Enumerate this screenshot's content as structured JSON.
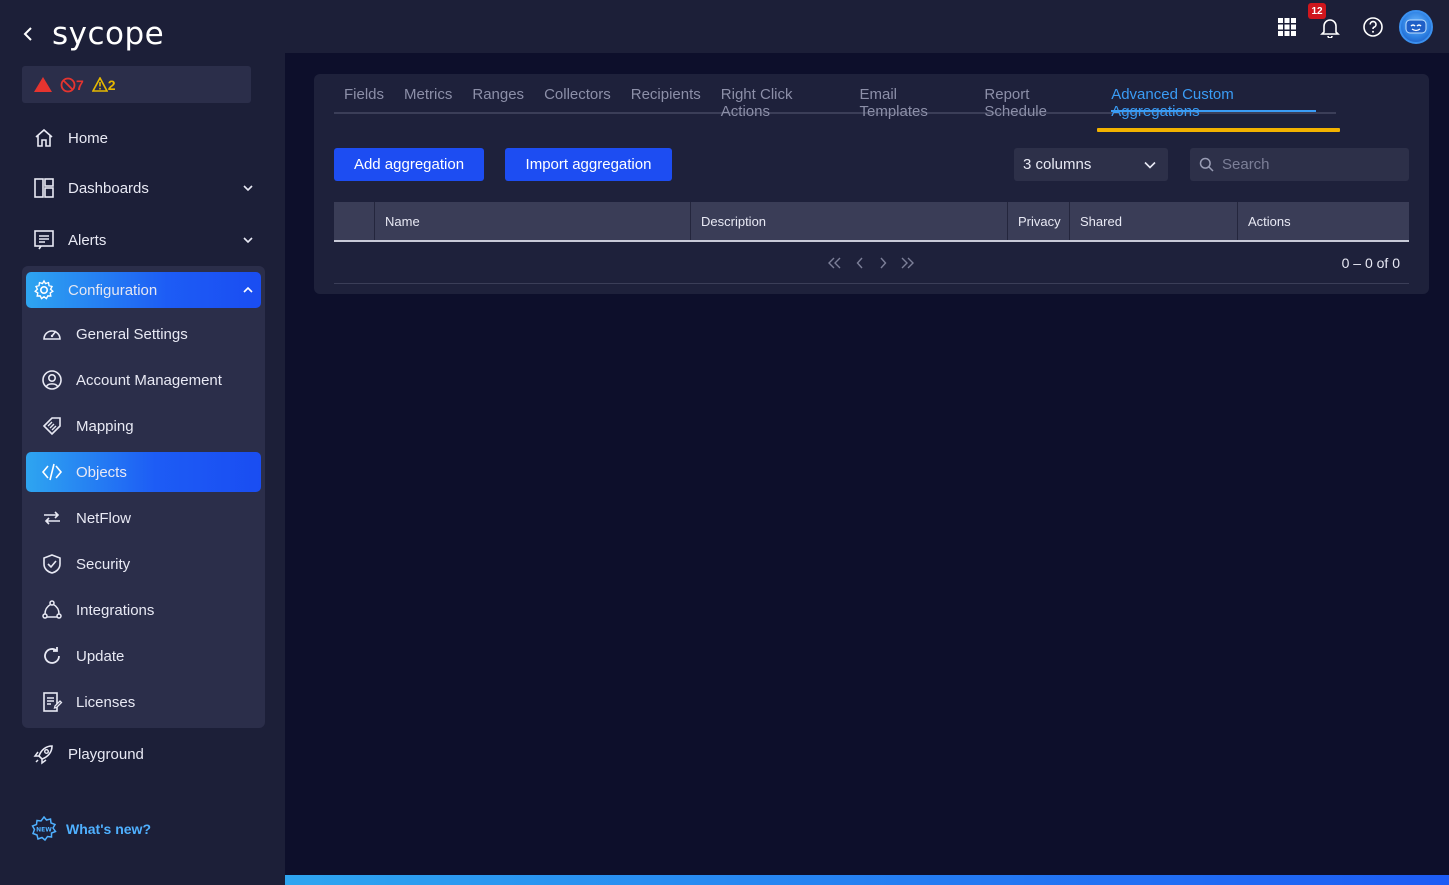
{
  "brand": {
    "logo": "sycope"
  },
  "alerts": {
    "critical_count": "7",
    "warning_count": "2"
  },
  "sidebar": {
    "items": [
      {
        "label": "Home"
      },
      {
        "label": "Dashboards"
      },
      {
        "label": "Alerts"
      }
    ],
    "configuration": {
      "label": "Configuration",
      "sub_items": [
        {
          "label": "General Settings"
        },
        {
          "label": "Account Management"
        },
        {
          "label": "Mapping"
        },
        {
          "label": "Objects"
        },
        {
          "label": "NetFlow"
        },
        {
          "label": "Security"
        },
        {
          "label": "Integrations"
        },
        {
          "label": "Update"
        },
        {
          "label": "Licenses"
        }
      ]
    },
    "playground": {
      "label": "Playground"
    },
    "whats_new": {
      "label": "What's new?"
    }
  },
  "topbar": {
    "notification_count": "12"
  },
  "tabs": [
    {
      "label": "Fields"
    },
    {
      "label": "Metrics"
    },
    {
      "label": "Ranges"
    },
    {
      "label": "Collectors"
    },
    {
      "label": "Recipients"
    },
    {
      "label": "Right Click Actions"
    },
    {
      "label": "Email Templates"
    },
    {
      "label": "Report Schedule"
    },
    {
      "label": "Advanced Custom Aggregations"
    }
  ],
  "toolbar": {
    "add_label": "Add aggregation",
    "import_label": "Import aggregation",
    "columns_value": "3 columns",
    "search_placeholder": "Search"
  },
  "table": {
    "columns": [
      "Name",
      "Description",
      "Privacy",
      "Shared",
      "Actions"
    ],
    "rows": []
  },
  "pagination": {
    "range": "0 – 0 of 0"
  },
  "colors": {
    "accent": "#1d4df2",
    "active_tab": "#3a9cf5",
    "highlight": "#f2b200",
    "critical": "#e5342f",
    "warning": "#e6b800"
  }
}
